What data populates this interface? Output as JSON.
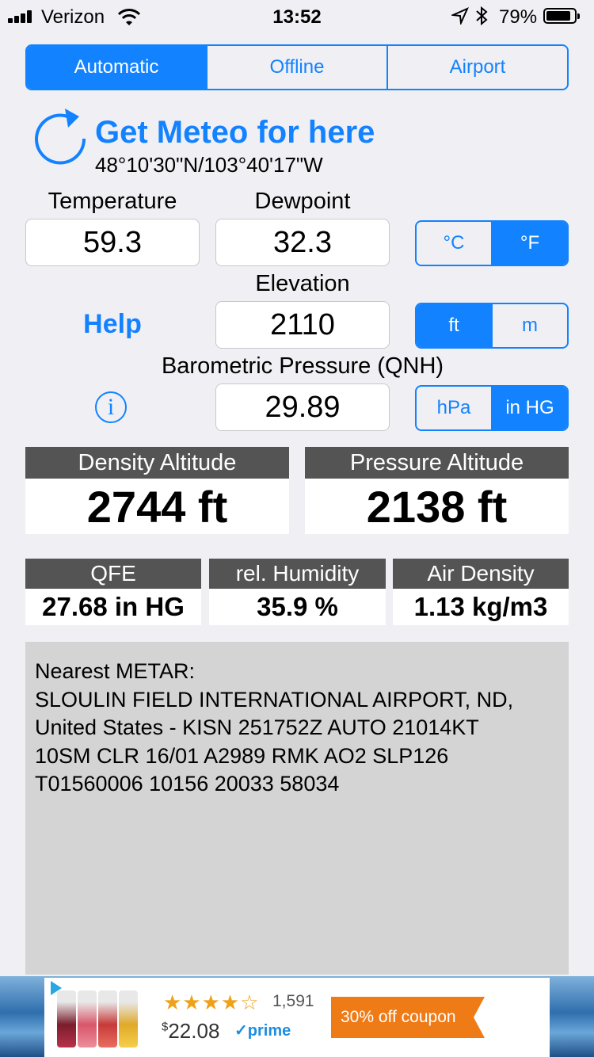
{
  "status_bar": {
    "carrier": "Verizon",
    "time": "13:52",
    "battery": "79%"
  },
  "mode_tabs": [
    {
      "label": "Automatic",
      "active": true
    },
    {
      "label": "Offline",
      "active": false
    },
    {
      "label": "Airport",
      "active": false
    }
  ],
  "location": {
    "action": "Get Meteo for here",
    "coordinates": "48°10'30\"N/103°40'17\"W"
  },
  "inputs": {
    "temperature": {
      "label": "Temperature",
      "value": "59.3"
    },
    "dewpoint": {
      "label": "Dewpoint",
      "value": "32.3"
    },
    "elevation": {
      "label": "Elevation",
      "value": "2110"
    },
    "pressure": {
      "label": "Barometric Pressure (QNH)",
      "value": "29.89"
    }
  },
  "units": {
    "temperature": [
      {
        "label": "°C",
        "selected": false
      },
      {
        "label": "°F",
        "selected": true
      }
    ],
    "elevation": [
      {
        "label": "ft",
        "selected": true
      },
      {
        "label": "m",
        "selected": false
      }
    ],
    "pressure": [
      {
        "label": "hPa",
        "selected": false
      },
      {
        "label": "in HG",
        "selected": true
      }
    ]
  },
  "help_label": "Help",
  "info_glyph": "i",
  "results": {
    "density_altitude": {
      "label": "Density Altitude",
      "value": "2744 ft"
    },
    "pressure_altitude": {
      "label": "Pressure Altitude",
      "value": "2138 ft"
    },
    "qfe": {
      "label": "QFE",
      "value": "27.68 in HG"
    },
    "humidity": {
      "label": "rel. Humidity",
      "value": "35.9 %"
    },
    "air_density": {
      "label": "Air Density",
      "value": "1.13 kg/m3"
    }
  },
  "metar": {
    "text": "Nearest METAR:\nSLOULIN FIELD INTERNATIONAL  AIRPORT, ND,\nUnited States - KISN 251752Z AUTO 21014KT\n10SM CLR 16/01 A2989 RMK AO2 SLP126\nT01560006 10156 20033 58034"
  },
  "ad": {
    "stars": "★★★★☆",
    "rating_count": "1,591",
    "currency": "$",
    "price": "22.08",
    "prime": "✓prime",
    "coupon": "30% off coupon"
  },
  "colors": {
    "accent": "#1382ff",
    "card_header": "#545454",
    "metar_bg": "#d4d4d4",
    "coupon": "#ef7b17"
  }
}
